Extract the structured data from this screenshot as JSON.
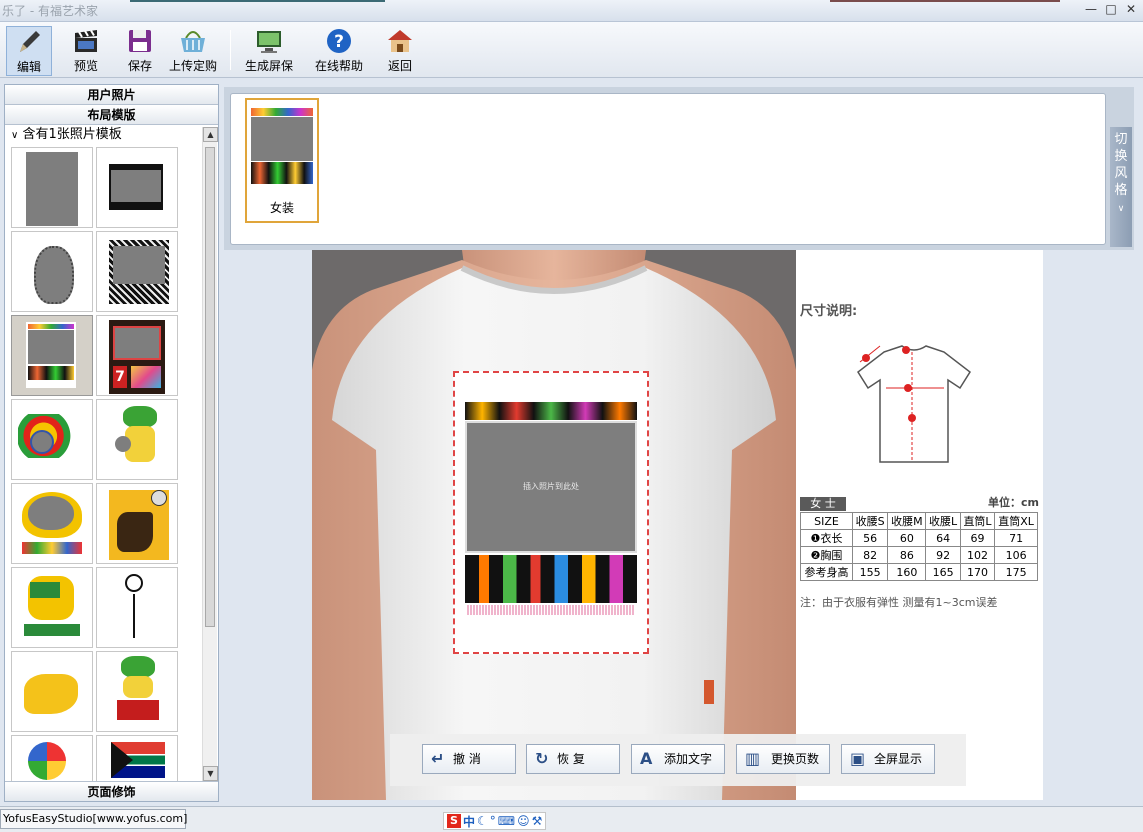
{
  "window": {
    "title": "乐了 - 有福艺术家",
    "controls": [
      "—",
      "□",
      "✕"
    ]
  },
  "toolbar": {
    "edit": "编辑",
    "preview": "预览",
    "save": "保存",
    "upload_order": "上传定购",
    "screensaver": "生成屏保",
    "help": "在线帮助",
    "back": "返回"
  },
  "left_panel": {
    "user_photos": "用户照片",
    "layout_templates": "布局模版",
    "group_label": "含有1张照片模板",
    "page_decoration": "页面修饰",
    "thumbnails": [
      {
        "name": "template-1"
      },
      {
        "name": "template-2"
      },
      {
        "name": "template-3"
      },
      {
        "name": "template-4"
      },
      {
        "name": "template-5"
      },
      {
        "name": "template-6"
      },
      {
        "name": "template-7"
      },
      {
        "name": "template-8"
      },
      {
        "name": "template-9"
      },
      {
        "name": "template-10"
      },
      {
        "name": "template-11"
      },
      {
        "name": "template-12"
      },
      {
        "name": "template-13"
      },
      {
        "name": "template-14"
      },
      {
        "name": "template-15"
      },
      {
        "name": "template-16"
      }
    ],
    "selected_index": 4
  },
  "style_panel": {
    "item_label": "女装",
    "switch_style": "切换风格"
  },
  "design": {
    "placeholder": "插入照片到此处"
  },
  "size_chart": {
    "title": "尺寸说明:",
    "category": "女 士",
    "unit": "单位：cm",
    "headers": [
      "SIZE",
      "收腰S",
      "收腰M",
      "收腰L",
      "直筒L",
      "直筒XL"
    ],
    "rows": [
      {
        "label": "❶衣长",
        "values": [
          "56",
          "60",
          "64",
          "69",
          "71"
        ]
      },
      {
        "label": "❷胸围",
        "values": [
          "82",
          "86",
          "92",
          "102",
          "106"
        ]
      },
      {
        "label": "参考身高",
        "values": [
          "155",
          "160",
          "165",
          "170",
          "175"
        ]
      }
    ],
    "note": "注：由于衣服有弹性 测量有1~3cm误差"
  },
  "actions": {
    "undo": "撤 消",
    "redo": "恢 复",
    "add_text": "添加文字",
    "change_pages": "更换页数",
    "fullscreen": "全屏显示"
  },
  "status": {
    "app": "YofusEasyStudio[www.yofus.com]",
    "ime": "中"
  }
}
